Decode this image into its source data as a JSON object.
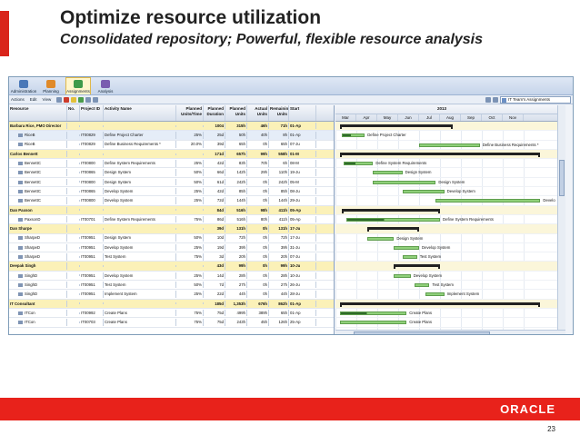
{
  "slide": {
    "title": "Optimize resource utilization",
    "subtitle": "Consolidated repository; Powerful, flexible resource analysis",
    "page_number": "23",
    "logo": "ORACLE",
    "accent_color": "#e8221b"
  },
  "app": {
    "nav": [
      {
        "label": "Administration",
        "icon": "admin-icon"
      },
      {
        "label": "Planning",
        "icon": "planning-icon"
      },
      {
        "label": "Assignments",
        "icon": "assignments-icon"
      },
      {
        "label": "Analysis",
        "icon": "analysis-icon"
      }
    ],
    "toolbar_menus": [
      "Actions",
      "Edit",
      "View"
    ],
    "team_select": "IT Team's Assignments",
    "columns": [
      "Resource",
      "No.",
      "Project ID",
      "Activity Name",
      "Planned Units/Time",
      "Planned Duration",
      "Planned Units",
      "Actual Units",
      "Remaining Units",
      "Start"
    ],
    "rows": [
      {
        "type": "group",
        "resource": "Barbara Rice, PMO Director",
        "pu": "",
        "pd": "1004",
        "pun": "315h",
        "au": "46h",
        "rem": "71h",
        "start": "01-Ap"
      },
      {
        "type": "item",
        "resource": "RiceB",
        "pid": "IT00829",
        "act": "Define Project Charter",
        "pu": "25%",
        "pd": "25d",
        "pun": "50h",
        "au": "40h",
        "rem": "8h",
        "start": "01-Ap"
      },
      {
        "type": "item",
        "resource": "RiceB",
        "pid": "IT00829",
        "act": "Define Business Requirements *",
        "pu": "20.0%",
        "pd": "39d",
        "pun": "65h",
        "au": "0h",
        "rem": "65h",
        "start": "07-Ju"
      },
      {
        "type": "group",
        "resource": "Carlos Bennett",
        "pd": "171d",
        "pun": "657h",
        "au": "99h",
        "rem": "558h",
        "start": "01-M"
      },
      {
        "type": "item",
        "resource": "BennettC",
        "pid": "IT00800",
        "act": "Define System Requirements",
        "pu": "25%",
        "pd": "42d",
        "pun": "83h",
        "au": "70h",
        "rem": "6h",
        "start": "08-M"
      },
      {
        "type": "item",
        "resource": "BennettC",
        "pid": "IT00865",
        "act": "Design System",
        "pu": "50%",
        "pd": "66d",
        "pun": "142h",
        "au": "29h",
        "rem": "110h",
        "start": "19-Ju"
      },
      {
        "type": "item",
        "resource": "BennettC",
        "pid": "IT00800",
        "act": "Design System",
        "pu": "50%",
        "pd": "61d",
        "pun": "242h",
        "au": "0h",
        "rem": "242h",
        "start": "05-M"
      },
      {
        "type": "item",
        "resource": "BennettC",
        "pid": "IT00865",
        "act": "Develop System",
        "pu": "25%",
        "pd": "42d",
        "pun": "85h",
        "au": "0h",
        "rem": "85h",
        "start": "08-Ju"
      },
      {
        "type": "item",
        "resource": "BennettC",
        "pid": "IT00800",
        "act": "Develop System",
        "pu": "25%",
        "pd": "72d",
        "pun": "144h",
        "au": "0h",
        "rem": "144h",
        "start": "29-Ju"
      },
      {
        "type": "group",
        "resource": "Dan Paxson",
        "pd": "84d",
        "pun": "516h",
        "au": "98h",
        "rem": "411h",
        "start": "05-Ap"
      },
      {
        "type": "item",
        "resource": "PaxsonD",
        "pid": "IT00701",
        "act": "Define System Requirements",
        "pu": "75%",
        "pd": "86d",
        "pun": "516h",
        "au": "80h",
        "rem": "411h",
        "start": "05-Ap"
      },
      {
        "type": "group",
        "resource": "Dan Sharpe",
        "pd": "39d",
        "pun": "131h",
        "au": "0h",
        "rem": "131h",
        "start": "17-Ju"
      },
      {
        "type": "item",
        "resource": "SharpeD",
        "pid": "IT00951",
        "act": "Design System",
        "pu": "50%",
        "pd": "10d",
        "pun": "72h",
        "au": "0h",
        "rem": "72h",
        "start": "17-Ju"
      },
      {
        "type": "item",
        "resource": "SharpeD",
        "pid": "IT00951",
        "act": "Develop System",
        "pu": "25%",
        "pd": "19d",
        "pun": "39h",
        "au": "0h",
        "rem": "39h",
        "start": "31-Ju"
      },
      {
        "type": "item",
        "resource": "SharpeD",
        "pid": "IT00951",
        "act": "Test System",
        "pu": "75%",
        "pd": "3d",
        "pun": "20h",
        "au": "0h",
        "rem": "20h",
        "start": "07-Ju"
      },
      {
        "type": "group",
        "resource": "Deepak Singh",
        "pd": "43d",
        "pun": "99h",
        "au": "0h",
        "rem": "99h",
        "start": "10-Ju"
      },
      {
        "type": "item",
        "resource": "SinghD",
        "pid": "IT00951",
        "act": "Develop System",
        "pu": "25%",
        "pd": "14d",
        "pun": "28h",
        "au": "0h",
        "rem": "28h",
        "start": "10-Ju"
      },
      {
        "type": "item",
        "resource": "SinghD",
        "pid": "IT00951",
        "act": "Test System",
        "pu": "50%",
        "pd": "7d",
        "pun": "27h",
        "au": "0h",
        "rem": "27h",
        "start": "26-Ju"
      },
      {
        "type": "item",
        "resource": "SinghD",
        "pid": "IT00951",
        "act": "Implement System",
        "pu": "25%",
        "pd": "22d",
        "pun": "44h",
        "au": "0h",
        "rem": "44h",
        "start": "28-Ju"
      },
      {
        "type": "group",
        "resource": "IT Consultant",
        "pd": "185d",
        "pun": "1,353h",
        "au": "676h",
        "rem": "862h",
        "start": "01-Ap"
      },
      {
        "type": "item",
        "resource": "ITCon",
        "pid": "IT00992",
        "act": "Create Plans",
        "pu": "75%",
        "pd": "75d",
        "pun": "499h",
        "au": "389h",
        "rem": "65h",
        "start": "01-Ap"
      },
      {
        "type": "item",
        "resource": "ITCon",
        "pid": "IT00703",
        "act": "Create Plans",
        "pu": "75%",
        "pd": "75d",
        "pun": "243h",
        "au": "45h",
        "rem": "126h",
        "start": "25-Ap"
      }
    ],
    "gantt": {
      "year": "2013",
      "months": [
        "Mar",
        "Apr",
        "May",
        "Jun",
        "Jul",
        "Aug",
        "Sep",
        "Oct",
        "Nov"
      ],
      "bars": [
        {
          "row": 0,
          "kind": "sum",
          "start": 0.2,
          "end": 5.6
        },
        {
          "row": 1,
          "kind": "prog",
          "start": 0.3,
          "end": 1.4,
          "label": "Define Project Charter"
        },
        {
          "row": 2,
          "kind": "bar",
          "start": 4.0,
          "end": 6.9,
          "label": "Define Business Requirements *"
        },
        {
          "row": 3,
          "kind": "sum",
          "start": 0.2,
          "end": 9.8
        },
        {
          "row": 4,
          "kind": "prog",
          "start": 0.4,
          "end": 1.8,
          "label": "Define System Requirements"
        },
        {
          "row": 5,
          "kind": "bar",
          "start": 1.8,
          "end": 3.2,
          "label": "Design System"
        },
        {
          "row": 6,
          "kind": "bar",
          "start": 1.8,
          "end": 4.8,
          "label": "Design System"
        },
        {
          "row": 7,
          "kind": "bar",
          "start": 3.2,
          "end": 5.2,
          "label": "Develop System"
        },
        {
          "row": 8,
          "kind": "bar",
          "start": 4.8,
          "end": 9.8,
          "label": "Develo"
        },
        {
          "row": 9,
          "kind": "sum",
          "start": 0.3,
          "end": 5.0
        },
        {
          "row": 10,
          "kind": "prog",
          "start": 0.5,
          "end": 5.0,
          "label": "Define System Requirements"
        },
        {
          "row": 11,
          "kind": "sum",
          "start": 1.5,
          "end": 4.0
        },
        {
          "row": 12,
          "kind": "bar",
          "start": 1.5,
          "end": 2.8,
          "label": "Design System"
        },
        {
          "row": 13,
          "kind": "bar",
          "start": 2.8,
          "end": 4.0,
          "label": "Develop System"
        },
        {
          "row": 14,
          "kind": "bar",
          "start": 3.2,
          "end": 3.9,
          "label": "Test System"
        },
        {
          "row": 15,
          "kind": "sum",
          "start": 2.8,
          "end": 5.0
        },
        {
          "row": 16,
          "kind": "bar",
          "start": 2.8,
          "end": 3.6,
          "label": "Develop System"
        },
        {
          "row": 17,
          "kind": "bar",
          "start": 3.8,
          "end": 4.5,
          "label": "Test System"
        },
        {
          "row": 18,
          "kind": "bar",
          "start": 4.3,
          "end": 5.2,
          "label": "Implement System"
        },
        {
          "row": 19,
          "kind": "sum",
          "start": 0.2,
          "end": 9.8
        },
        {
          "row": 20,
          "kind": "prog",
          "start": 0.2,
          "end": 3.4,
          "label": "Create Plans"
        },
        {
          "row": 21,
          "kind": "bar",
          "start": 0.2,
          "end": 3.4,
          "label": "Create Plans"
        }
      ]
    }
  }
}
